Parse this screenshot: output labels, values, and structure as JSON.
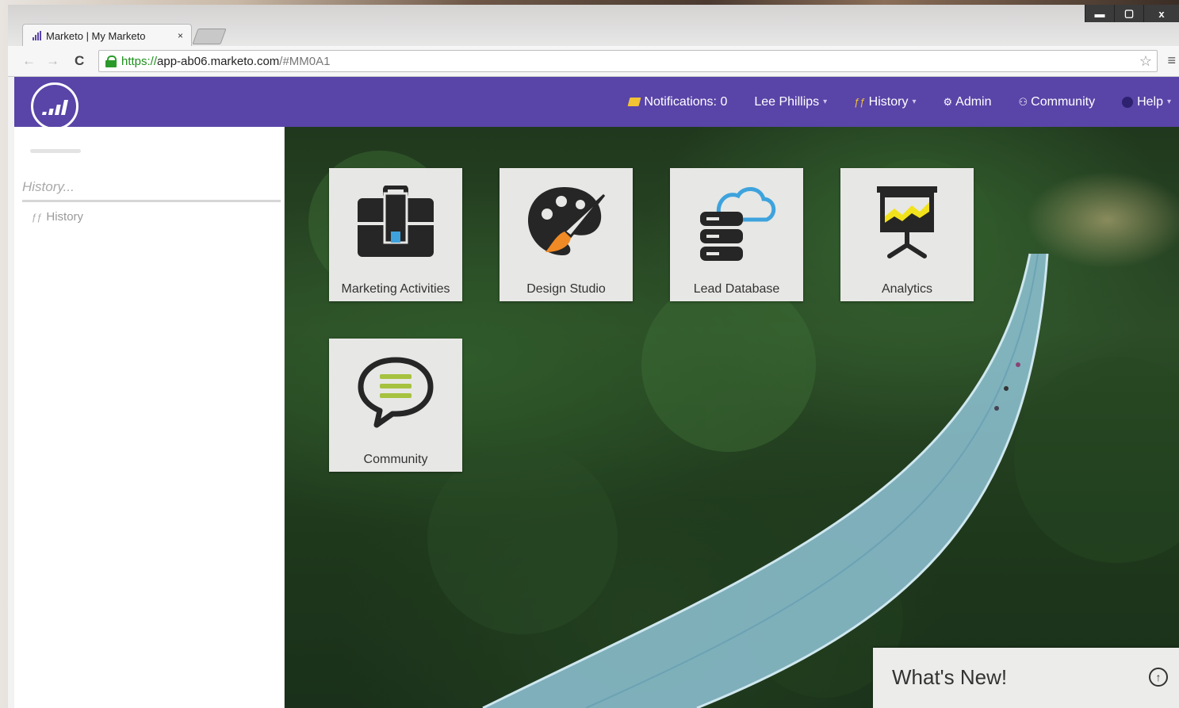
{
  "browser": {
    "tab_title": "Marketo | My Marketo",
    "tab_close": "×",
    "url_scheme": "https://",
    "url_host": "app-ab06.marketo.com",
    "url_rest": "/#MM0A1",
    "window_buttons": {
      "minimize": "▬",
      "maximize": "▢",
      "close": "x"
    },
    "nav": {
      "back": "←",
      "forward": "→",
      "reload": "C"
    },
    "star": "☆",
    "menu": "≡"
  },
  "topnav": {
    "notifications": "Notifications: 0",
    "user": "Lee Phillips",
    "history": "History",
    "admin": "Admin",
    "community": "Community",
    "help": "Help"
  },
  "sidebar": {
    "search_placeholder": "History...",
    "history_item": "History"
  },
  "tiles": [
    {
      "label": "Marketing Activities",
      "icon": "briefcase-icon"
    },
    {
      "label": "Design Studio",
      "icon": "palette-icon"
    },
    {
      "label": "Lead Database",
      "icon": "database-cloud-icon"
    },
    {
      "label": "Analytics",
      "icon": "presentation-chart-icon"
    },
    {
      "label": "Community",
      "icon": "speech-bubble-icon"
    }
  ],
  "whats_new": {
    "label": "What's New!"
  },
  "colors": {
    "brand_purple": "#5944a8",
    "icon_dark": "#262626",
    "accent_blue": "#3ea3dd",
    "accent_yellow": "#f2e21b",
    "accent_green": "#a6c23f",
    "accent_orange": "#f08a24"
  }
}
